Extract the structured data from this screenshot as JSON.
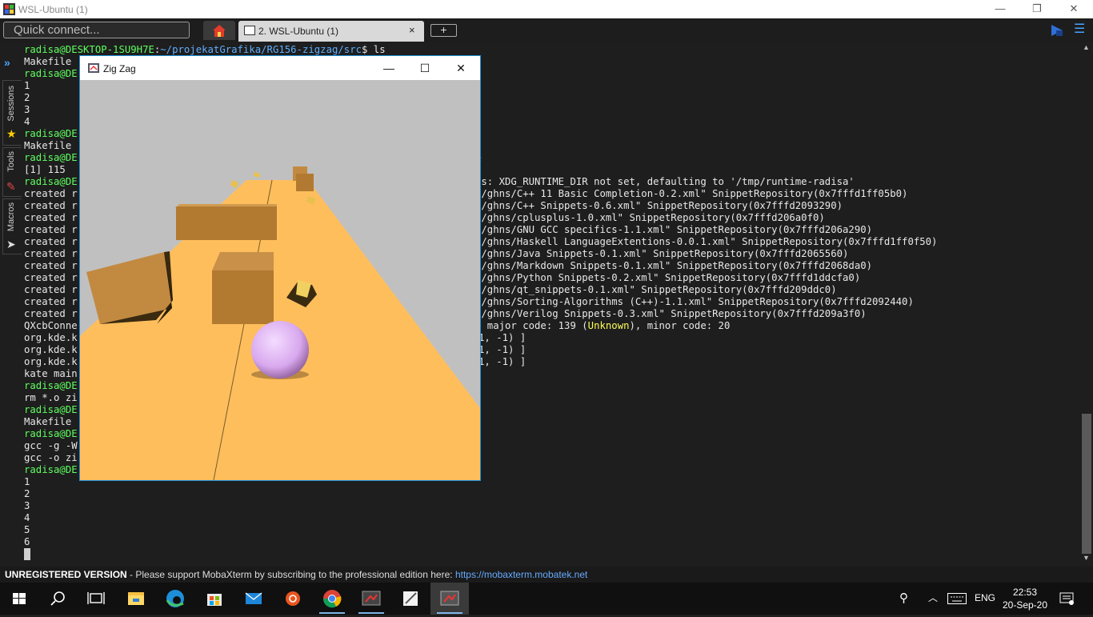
{
  "window": {
    "title": "WSL-Ubuntu (1)",
    "controls": [
      "minimize",
      "restore",
      "close"
    ]
  },
  "toolbar": {
    "quick_connect_placeholder": "Quick connect...",
    "active_tab_label": "2. WSL-Ubuntu (1)",
    "tab_close": "×",
    "new_tab": "+"
  },
  "sidebar": {
    "tabs": [
      "Sessions",
      "Tools",
      "Macros"
    ]
  },
  "terminal": {
    "prompt_user": "radisa@DESKTOP-1SU9H7E",
    "prompt_path": "~/projekatGrafika/RG156-zigzag/src",
    "first_cmd": "$ ls",
    "left_lines": [
      "Makefile",
      "radisa@DE",
      "1",
      "2",
      "3",
      "4",
      "radisa@DE",
      "Makefile",
      "radisa@DE",
      "[1] 115",
      "radisa@DE",
      "created r",
      "created r",
      "created r",
      "created r",
      "created r",
      "created r",
      "created r",
      "created r",
      "created r",
      "created r",
      "created r",
      "QXcbConne",
      "org.kde.k",
      "org.kde.k",
      "org.kde.k",
      "kate main",
      "radisa@DE",
      "rm *.o zi",
      "radisa@DE",
      "Makefile",
      "radisa@DE",
      "gcc -g -W",
      "gcc -o zi",
      "radisa@DE",
      "1",
      "2",
      "3",
      "4",
      "5",
      "6"
    ],
    "right_amp": "&",
    "right_lines": [
      "ns: XDG_RUNTIME_DIR not set, defaulting to '/tmp/runtime-radisa'",
      "s/ghns/C++ 11 Basic Completion-0.2.xml\" SnippetRepository(0x7fffd1ff05b0)",
      "s/ghns/C++ Snippets-0.6.xml\" SnippetRepository(0x7fffd2093290)",
      "s/ghns/cplusplus-1.0.xml\" SnippetRepository(0x7fffd206a0f0)",
      "s/ghns/GNU GCC specifics-1.1.xml\" SnippetRepository(0x7fffd206a290)",
      "s/ghns/Haskell LanguageExtentions-0.0.1.xml\" SnippetRepository(0x7fffd1ff0f50)",
      "s/ghns/Java Snippets-0.1.xml\" SnippetRepository(0x7fffd2065560)",
      "s/ghns/Markdown Snippets-0.1.xml\" SnippetRepository(0x7fffd2068da0)",
      "s/ghns/Python Snippets-0.2.xml\" SnippetRepository(0x7fffd1ddcfa0)",
      "s/ghns/qt_snippets-0.1.xml\" SnippetRepository(0x7fffd209ddc0)",
      "s/ghns/Sorting-Algorithms (C++)-1.1.xml\" SnippetRepository(0x7fffd2092440)",
      "s/ghns/Verilog Snippets-0.3.xml\" SnippetRepository(0x7fffd209a3f0)"
    ],
    "xcb_pre": ", major code: 139 (",
    "xcb_unknown": "Unknown",
    "xcb_post": "), minor code: 20",
    "kde_tails": [
      "1, -1) ]",
      "1, -1) ]",
      "1, -1) ]"
    ]
  },
  "game_window": {
    "title": "Zig Zag",
    "controls": [
      "—",
      "☐",
      "✕"
    ]
  },
  "statusbar": {
    "bold": "UNREGISTERED VERSION",
    "text": " - Please support MobaXterm by subscribing to the professional edition here: ",
    "link": "https://mobaxterm.mobatek.net"
  },
  "taskbar": {
    "lang": "ENG",
    "time": "22:53",
    "date": "20-Sep-20"
  },
  "colors": {
    "prompt_green": "#5fff5f",
    "path_blue": "#5fafff",
    "accent_blue": "#1e8fd6",
    "platform": "#ffbe5c",
    "sky": "#c0c0c0",
    "box": "#c28a40",
    "ball": "#e0b0f0"
  }
}
